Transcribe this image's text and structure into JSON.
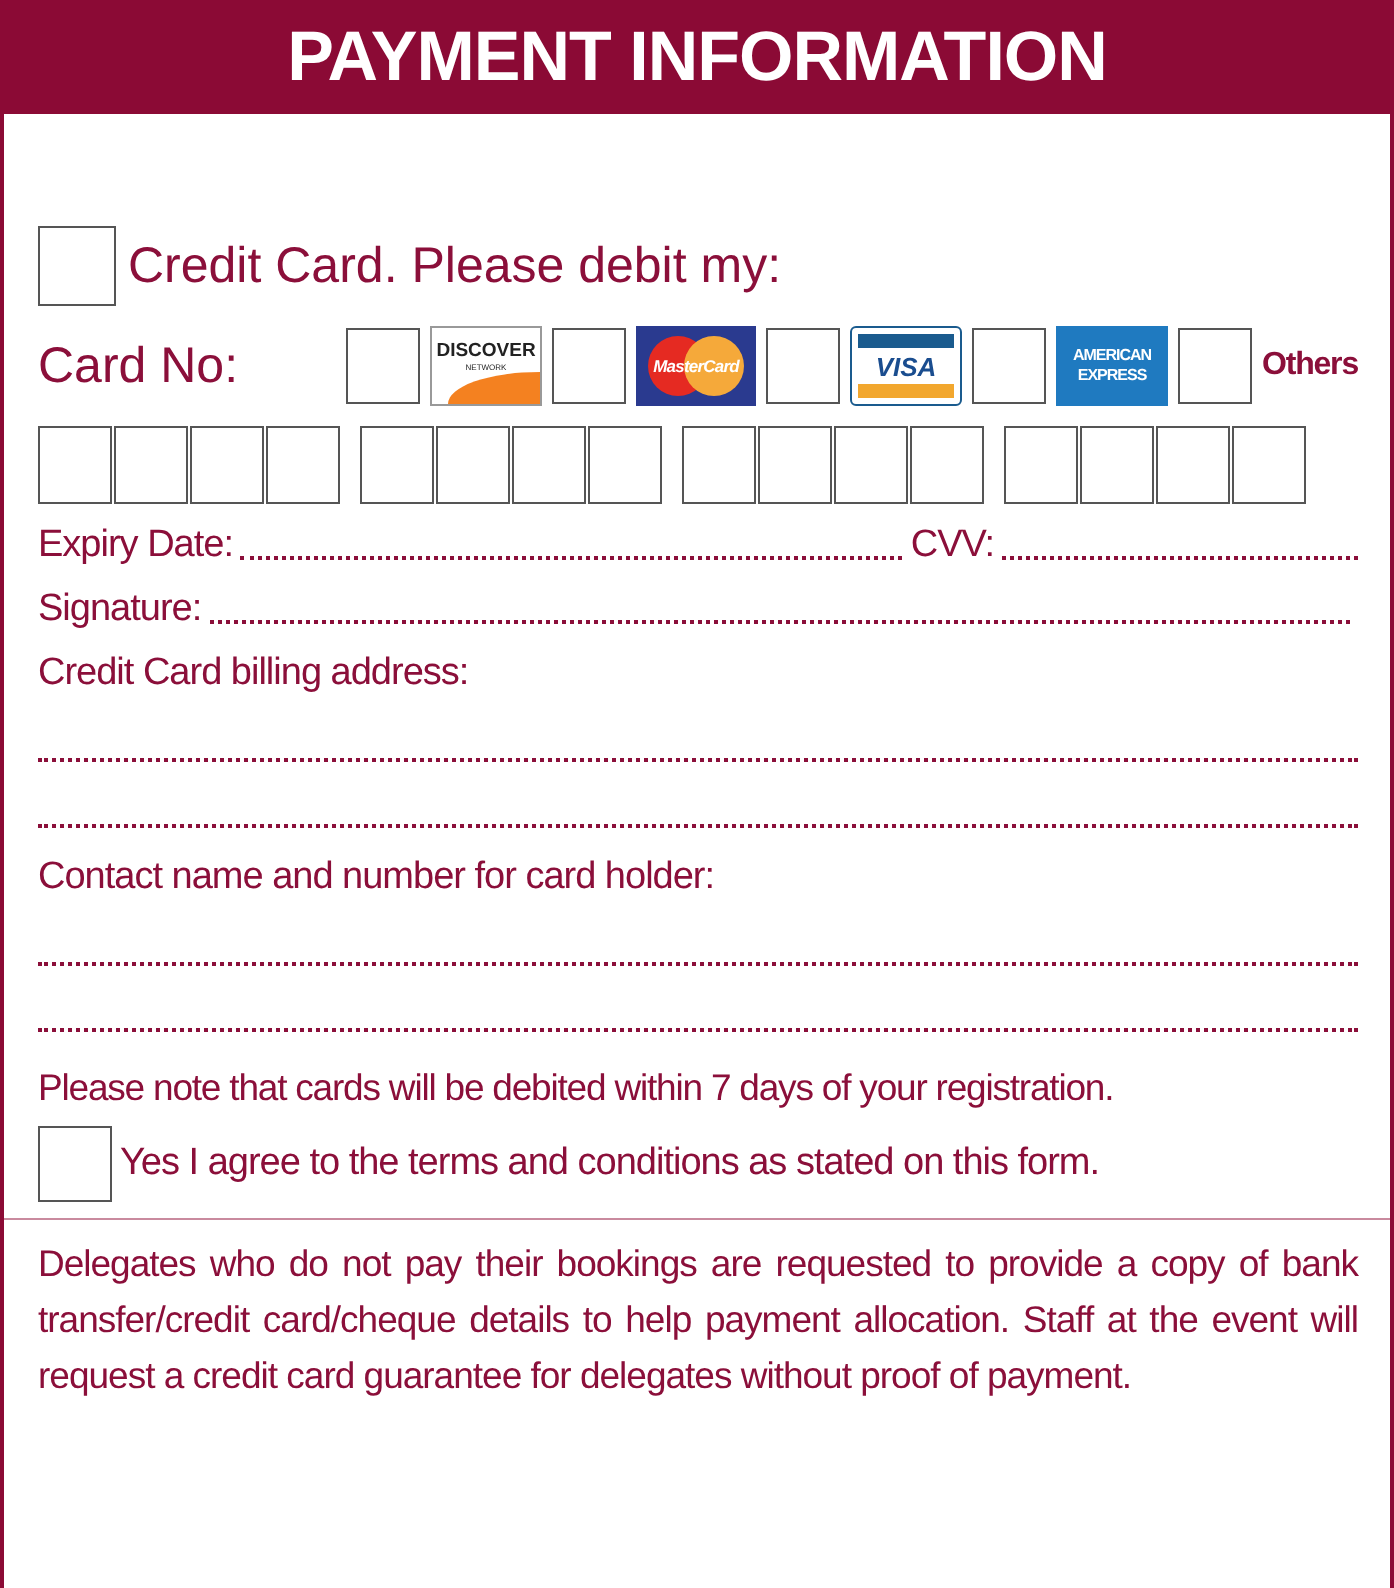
{
  "title": "PAYMENT INFORMATION",
  "credit_card": {
    "checked": false,
    "label": "Credit Card. Please debit my:"
  },
  "card_no": {
    "label": "Card No:"
  },
  "card_types": [
    {
      "kind": "discover",
      "checked": false,
      "label": "DISCOVER",
      "sublabel": "NETWORK"
    },
    {
      "kind": "mastercard",
      "checked": false,
      "label": "MasterCard"
    },
    {
      "kind": "visa",
      "checked": false,
      "label": "VISA"
    },
    {
      "kind": "amex",
      "checked": false,
      "label": "AMERICAN",
      "sublabel": "EXPRESS"
    },
    {
      "kind": "text",
      "checked": false,
      "label": "Others"
    }
  ],
  "expiry": {
    "label": "Expiry Date:"
  },
  "cvv": {
    "label": "CVV:"
  },
  "signature": {
    "label": "Signature:"
  },
  "billing": {
    "label": "Credit Card billing address:"
  },
  "contact": {
    "label": "Contact name and number for card holder:"
  },
  "note": "Please note that cards will be debited within 7 days of your registration.",
  "agree": {
    "checked": false,
    "label": "Yes I agree to the terms and conditions as stated on this form."
  },
  "footer": "Delegates who do not pay their bookings are requested to provide a copy of bank transfer/credit card/cheque details to help payment allocation. Staff at the event will request a credit card guarantee for delegates without proof of payment."
}
